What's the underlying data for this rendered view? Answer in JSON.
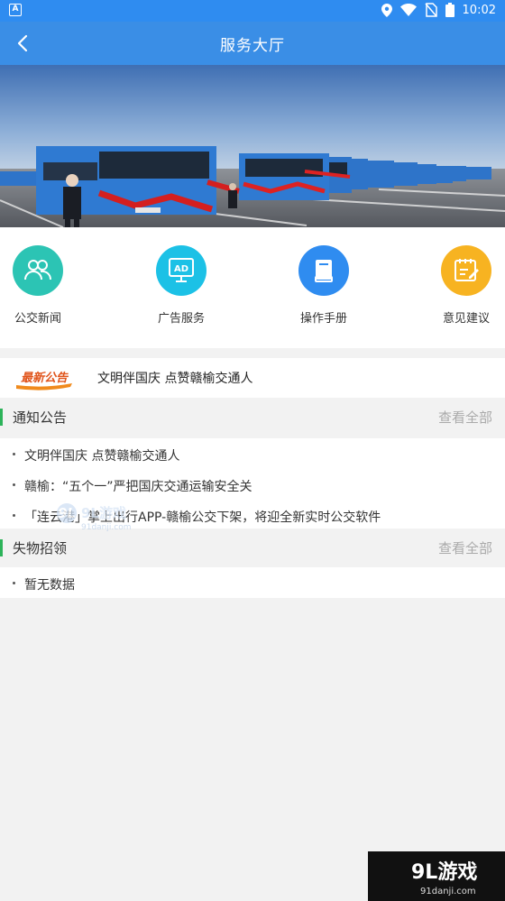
{
  "status_bar": {
    "time": "10:02"
  },
  "header": {
    "title": "服务大厅"
  },
  "menu": [
    {
      "label": "公交新闻",
      "color": "#2cc4b4",
      "icon": "people-icon"
    },
    {
      "label": "广告服务",
      "color": "#1cc1e6",
      "icon": "ad-monitor-icon"
    },
    {
      "label": "操作手册",
      "color": "#2f8cf0",
      "icon": "book-icon"
    },
    {
      "label": "意见建议",
      "color": "#f7b321",
      "icon": "edit-note-icon"
    }
  ],
  "latest": {
    "badge": "最新公告",
    "text": "文明伴国庆 点赞赣榆交通人"
  },
  "notices": {
    "title": "通知公告",
    "more": "查看全部",
    "items": [
      "文明伴国庆 点赞赣榆交通人",
      "赣榆：“五个一”严把国庆交通运输安全关",
      "「连云港」掌上出行APP-赣榆公交下架，将迎全新实时公交软件"
    ]
  },
  "lost_found": {
    "title": "失物招领",
    "more": "查看全部",
    "items": [
      "暂无数据"
    ]
  },
  "watermark": {
    "logo": "9L游戏",
    "url": "91danji.com"
  }
}
